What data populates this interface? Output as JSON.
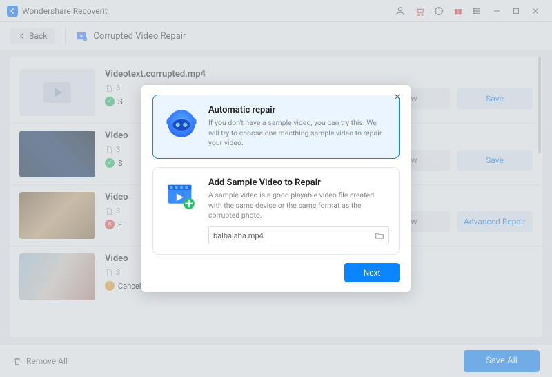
{
  "app": {
    "title": "Wondershare Recoverit"
  },
  "toolbar": {
    "back": "Back",
    "section": "Corrupted Video Repair"
  },
  "items": [
    {
      "name": "Videotext.corrupted.mp4",
      "meta": "3",
      "status": "S",
      "statusKind": "ok",
      "preview": "ew",
      "action": "Save"
    },
    {
      "name": "Video",
      "meta": "3",
      "status": "S",
      "statusKind": "ok",
      "preview": "ew",
      "action": "Save"
    },
    {
      "name": "Video",
      "meta": "3",
      "status": "F",
      "statusKind": "err",
      "preview": "ew",
      "action": "Advanced Repair"
    },
    {
      "name": "Video",
      "meta": "3",
      "status": "Canceled",
      "statusKind": "warn",
      "preview": "",
      "action": ""
    }
  ],
  "footer": {
    "removeAll": "Remove All",
    "saveAll": "Save All"
  },
  "modal": {
    "auto": {
      "title": "Automatic repair",
      "desc": "If you don't have a sample video, you can try this. We will try to choose one macthing sample video to repair your video."
    },
    "sample": {
      "title": "Add Sample Video to Repair",
      "desc": "A sample video is a good playable video file created with the same device or the same format as the corrupted photo.",
      "filename": "balbalaba.mp4"
    },
    "next": "Next"
  }
}
